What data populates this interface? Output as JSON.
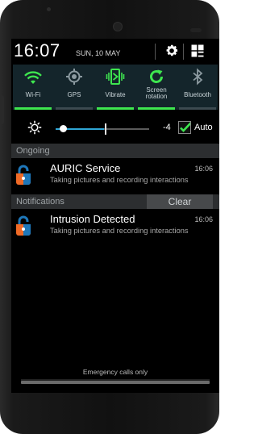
{
  "status": {
    "time": "16:07",
    "date": "SUN, 10 MAY"
  },
  "header_icons": {
    "settings": "gear-icon",
    "tiles": "grid-toggle-icon"
  },
  "toggles": [
    {
      "label": "Wi-Fi",
      "icon": "wifi-icon",
      "on": true
    },
    {
      "label": "GPS",
      "icon": "gps-icon",
      "on": false
    },
    {
      "label": "Vibrate",
      "icon": "vibrate-icon",
      "on": true
    },
    {
      "label": "Screen rotation",
      "icon": "rotation-icon",
      "on": true
    },
    {
      "label": "Bluetooth",
      "icon": "bluetooth-icon",
      "on": false
    }
  ],
  "brightness": {
    "value": "-4",
    "auto_label": "Auto",
    "auto_checked": true
  },
  "sections": {
    "ongoing": "Ongoing",
    "notifications": "Notifications",
    "clear": "Clear"
  },
  "ongoing": {
    "title": "AURIC Service",
    "text": "Taking pictures and recording interactions",
    "time": "16:06"
  },
  "notification": {
    "title": "Intrusion Detected",
    "text": "Taking pictures and recording interactions",
    "time": "16:06"
  },
  "footer": {
    "emergency": "Emergency calls only"
  },
  "colors": {
    "accent_green": "#3ee64f",
    "accent_blue": "#2fa6d6",
    "icon_orange": "#f06a26",
    "icon_blue": "#1e77b9"
  }
}
